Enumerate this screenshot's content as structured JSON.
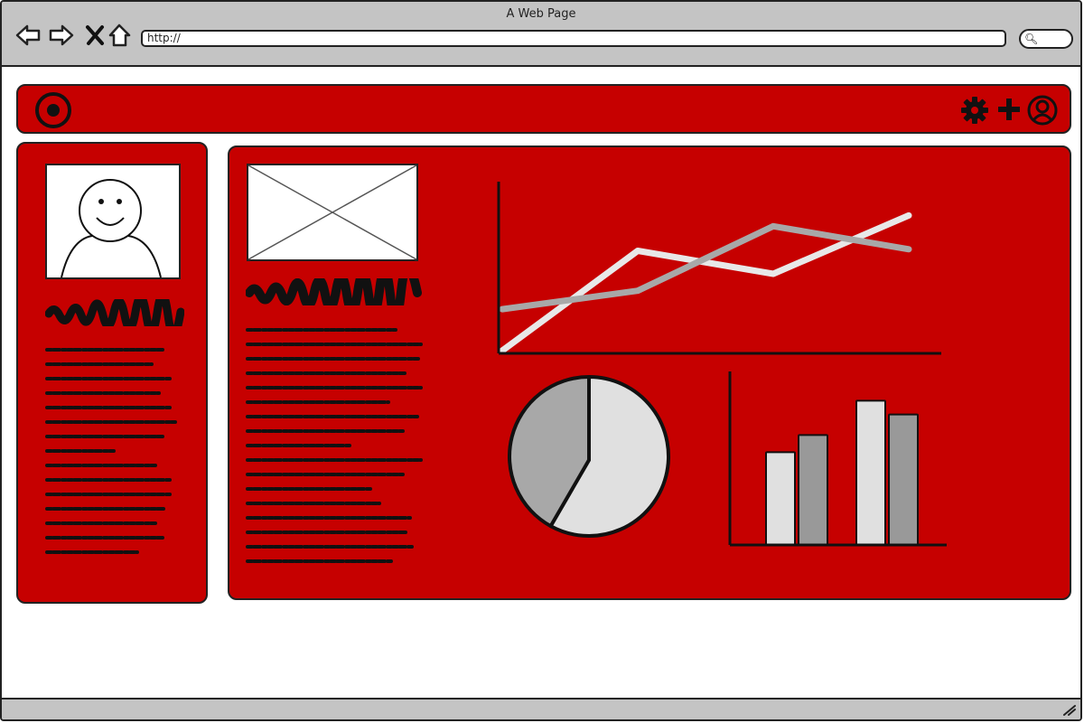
{
  "window": {
    "title": "A Web Page"
  },
  "address_bar": {
    "url": "http://"
  },
  "toolbar": {
    "icons": [
      "back-icon",
      "forward-icon",
      "stop-icon",
      "home-icon"
    ]
  },
  "header": {
    "logo_icon": "target-icon",
    "actions": [
      "gear-icon",
      "plus-icon",
      "user-icon"
    ]
  },
  "colors": {
    "accent": "#c60000",
    "chrome": "#c4c4c4",
    "outline": "#222222",
    "line_light": "#e8e8e8",
    "line_dark": "#a8a8a8",
    "bar_light": "#e0e0e0",
    "bar_dark": "#999999"
  },
  "chart_data": [
    {
      "type": "line",
      "x": [
        0,
        1,
        2,
        3
      ],
      "series": [
        {
          "values": [
            0.0,
            0.65,
            0.5,
            0.88
          ]
        },
        {
          "values": [
            0.27,
            0.39,
            0.81,
            0.66
          ]
        }
      ],
      "ylim": [
        0,
        1
      ],
      "grid": false
    },
    {
      "type": "pie",
      "values": [
        58,
        42
      ]
    },
    {
      "type": "bar",
      "categories": [
        "",
        ""
      ],
      "series": [
        {
          "values": [
            0.54,
            0.64
          ]
        },
        {
          "values": [
            0.84,
            0.76
          ]
        }
      ],
      "ylim": [
        0,
        1
      ],
      "grid": false
    }
  ]
}
